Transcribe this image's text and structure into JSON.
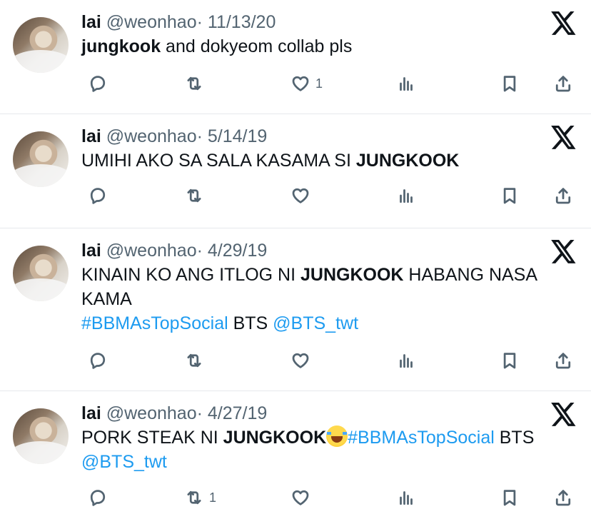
{
  "colors": {
    "text": "#0f1419",
    "secondary": "#536471",
    "link": "#1d9bf0",
    "divider": "#e6e9ec"
  },
  "tweets": [
    {
      "name": "lai",
      "handle": "@weonhao",
      "separator": "·",
      "date": "11/13/20",
      "text": [
        {
          "t": "jungkook",
          "style": "bold"
        },
        {
          "t": " and dokyeom collab pls",
          "style": "plain"
        }
      ],
      "counts": {
        "reply": "",
        "retweet": "",
        "like": "1"
      }
    },
    {
      "name": "lai",
      "handle": "@weonhao",
      "separator": "·",
      "date": "5/14/19",
      "text": [
        {
          "t": "UMIHI AKO SA SALA KASAMA SI ",
          "style": "plain"
        },
        {
          "t": "JUNGKOOK",
          "style": "bold"
        }
      ],
      "counts": {
        "reply": "",
        "retweet": "",
        "like": ""
      }
    },
    {
      "name": "lai",
      "handle": "@weonhao",
      "separator": "·",
      "date": "4/29/19",
      "text": [
        {
          "t": "KINAIN KO ANG ITLOG NI ",
          "style": "plain"
        },
        {
          "t": "JUNGKOOK",
          "style": "bold"
        },
        {
          "t": " HABANG NASA KAMA",
          "style": "plain"
        },
        {
          "t": "",
          "style": "br"
        },
        {
          "t": "#BBMAsTopSocial",
          "style": "link"
        },
        {
          "t": " BTS ",
          "style": "plain"
        },
        {
          "t": "@BTS_twt",
          "style": "link"
        }
      ],
      "counts": {
        "reply": "",
        "retweet": "",
        "like": ""
      }
    },
    {
      "name": "lai",
      "handle": "@weonhao",
      "separator": "·",
      "date": "4/27/19",
      "text": [
        {
          "t": "PORK STEAK NI ",
          "style": "plain"
        },
        {
          "t": "JUNGKOOK",
          "style": "bold"
        },
        {
          "t": "",
          "style": "emoji",
          "icon": "face-with-tears-of-joy-emoji"
        },
        {
          "t": "#BBMAsTopSocial",
          "style": "link"
        },
        {
          "t": " BTS ",
          "style": "plain"
        },
        {
          "t": "@BTS_twt",
          "style": "link"
        }
      ],
      "counts": {
        "reply": "",
        "retweet": "1",
        "like": ""
      }
    }
  ],
  "icons": [
    "x-logo-icon",
    "reply-icon",
    "retweet-icon",
    "like-icon",
    "views-icon",
    "bookmark-icon",
    "share-icon"
  ]
}
